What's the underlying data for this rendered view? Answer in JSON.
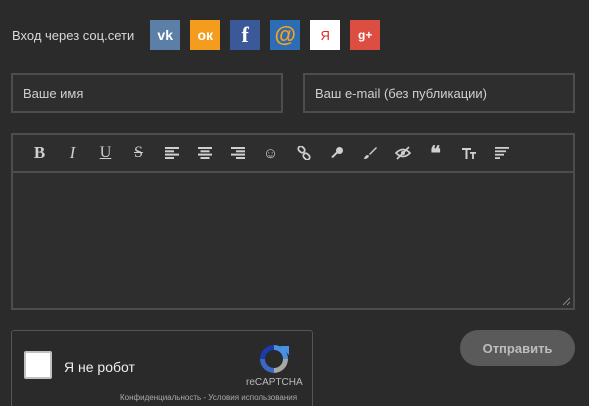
{
  "social": {
    "label": "Вход через соц.сети",
    "buttons": [
      {
        "icon": "vk-icon",
        "glyph": "vk"
      },
      {
        "icon": "odnoklassniki-icon",
        "glyph": "ок"
      },
      {
        "icon": "facebook-icon",
        "glyph": "f"
      },
      {
        "icon": "mailru-icon",
        "glyph": "@"
      },
      {
        "icon": "yandex-icon",
        "glyph": "Я"
      },
      {
        "icon": "google-plus-icon",
        "glyph": "g+"
      }
    ]
  },
  "form": {
    "name_placeholder": "Ваше имя",
    "email_placeholder": "Ваш e-mail (без публикации)"
  },
  "toolbar": {
    "bold": "B",
    "italic": "I",
    "underline": "U",
    "strike": "S",
    "quote": "❝",
    "smile": "☺"
  },
  "captcha": {
    "label": "Я не робот",
    "brand": "reCAPTCHA",
    "links": "Конфиденциальность - Условия использования"
  },
  "submit_label": "Отправить"
}
